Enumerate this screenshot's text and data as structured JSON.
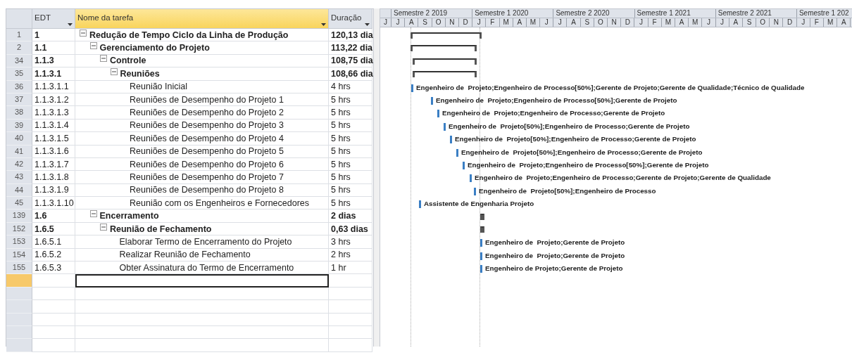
{
  "table": {
    "columns": [
      {
        "label": "EDT",
        "selected": false
      },
      {
        "label": "Nome da tarefa",
        "selected": true
      },
      {
        "label": "Duração",
        "selected": false
      }
    ],
    "tasks": [
      {
        "row": "1",
        "edt": "1",
        "name": "Redução de Tempo Ciclo da Linha de Produção",
        "duration": "120,13 dia",
        "expanded": true,
        "children": [
          {
            "row": "2",
            "edt": "1.1",
            "name": "Gerenciamento do Projeto",
            "duration": "113,22 dia",
            "expanded": true,
            "children": [
              {
                "row": "34",
                "edt": "1.1.3",
                "name": "Controle",
                "duration": "108,75 dia",
                "expanded": true,
                "children": [
                  {
                    "row": "35",
                    "edt": "1.1.3.1",
                    "name": "Reuniões",
                    "duration": "108,66 dia",
                    "expanded": true,
                    "children": [
                      {
                        "row": "36",
                        "edt": "1.1.3.1.1",
                        "name": "Reunião Inicial",
                        "duration": "4 hrs",
                        "resources": "Engenheiro de  Projeto;Engenheiro de Processo[50%];Gerente de Projeto;Gerente de Qualidade;Técnico de Qualidade"
                      },
                      {
                        "row": "37",
                        "edt": "1.1.3.1.2",
                        "name": "Reuniões de Desempenho do Projeto 1",
                        "duration": "5 hrs",
                        "resources": "Engenheiro de  Projeto;Engenheiro de Processo[50%];Gerente de Projeto"
                      },
                      {
                        "row": "38",
                        "edt": "1.1.3.1.3",
                        "name": "Reuniões de Desempenho do Projeto 2",
                        "duration": "5 hrs",
                        "resources": "Engenheiro de  Projeto;Engenheiro de Processo;Gerente de Projeto"
                      },
                      {
                        "row": "39",
                        "edt": "1.1.3.1.4",
                        "name": "Reuniões de Desempenho do Projeto 3",
                        "duration": "5 hrs",
                        "resources": "Engenheiro de  Projeto[50%];Engenheiro de Processo;Gerente de Projeto"
                      },
                      {
                        "row": "40",
                        "edt": "1.1.3.1.5",
                        "name": "Reuniões de Desempenho do Projeto 4",
                        "duration": "5 hrs",
                        "resources": "Engenheiro de  Projeto[50%];Engenheiro de Processo;Gerente de Projeto"
                      },
                      {
                        "row": "41",
                        "edt": "1.1.3.1.6",
                        "name": "Reuniões de Desempenho do Projeto 5",
                        "duration": "5 hrs",
                        "resources": "Engenheiro de  Projeto[50%];Engenheiro de Processo;Gerente de Projeto"
                      },
                      {
                        "row": "42",
                        "edt": "1.1.3.1.7",
                        "name": "Reuniões de Desempenho do Projeto 6",
                        "duration": "5 hrs",
                        "resources": "Engenheiro de  Projeto;Engenheiro de Processo[50%];Gerente de Projeto"
                      },
                      {
                        "row": "43",
                        "edt": "1.1.3.1.8",
                        "name": "Reuniões de Desempenho do Projeto 7",
                        "duration": "5 hrs",
                        "resources": "Engenheiro de  Projeto;Engenheiro de Processo;Gerente de Projeto;Gerente de Qualidade"
                      },
                      {
                        "row": "44",
                        "edt": "1.1.3.1.9",
                        "name": "Reuniões de Desempenho do Projeto 8",
                        "duration": "5 hrs",
                        "resources": "Engenheiro de  Projeto[50%];Engenheiro de Processo"
                      },
                      {
                        "row": "45",
                        "edt": "1.1.3.1.10",
                        "name": "Reunião com os Engenheiros e Fornecedores",
                        "duration": "5 hrs",
                        "resources": "Assistente de Engenharia Projeto"
                      }
                    ]
                  }
                ]
              }
            ]
          },
          {
            "row": "139",
            "edt": "1.6",
            "name": "Encerramento",
            "duration": "2 dias",
            "expanded": true,
            "children": [
              {
                "row": "152",
                "edt": "1.6.5",
                "name": "Reunião de Fechamento",
                "duration": "0,63 dias",
                "expanded": true,
                "children": [
                  {
                    "row": "153",
                    "edt": "1.6.5.1",
                    "name": "Elaborar Termo de Encerramento do Projeto",
                    "duration": "3 hrs",
                    "resources": "Engenheiro de  Projeto;Gerente de Projeto"
                  },
                  {
                    "row": "154",
                    "edt": "1.6.5.2",
                    "name": "Realizar Reunião de Fechamento",
                    "duration": "2 hrs",
                    "resources": "Engenheiro de  Projeto;Gerente de Projeto"
                  },
                  {
                    "row": "155",
                    "edt": "1.6.5.3",
                    "name": "Obter Assinatura do Termo de Encerramento",
                    "duration": "1 hr",
                    "resources": "Engenheiro de Projeto;Gerente de Projeto"
                  }
                ]
              }
            ]
          }
        ]
      }
    ]
  },
  "timescale": {
    "semesters": [
      "Semestre 2 2019",
      "Semestre 1 2020",
      "Semestre 2 2020",
      "Semestre 1 2021",
      "Semestre 2 2021",
      "Semestre 1 202"
    ],
    "months": [
      "J",
      "J",
      "A",
      "S",
      "O",
      "N",
      "D",
      "J",
      "F",
      "M",
      "A",
      "M",
      "J",
      "J",
      "A",
      "S",
      "O",
      "N",
      "D",
      "J",
      "F",
      "M",
      "A",
      "M",
      "J",
      "J",
      "A",
      "S",
      "O",
      "N",
      "D",
      "J",
      "F",
      "M",
      "A"
    ]
  }
}
